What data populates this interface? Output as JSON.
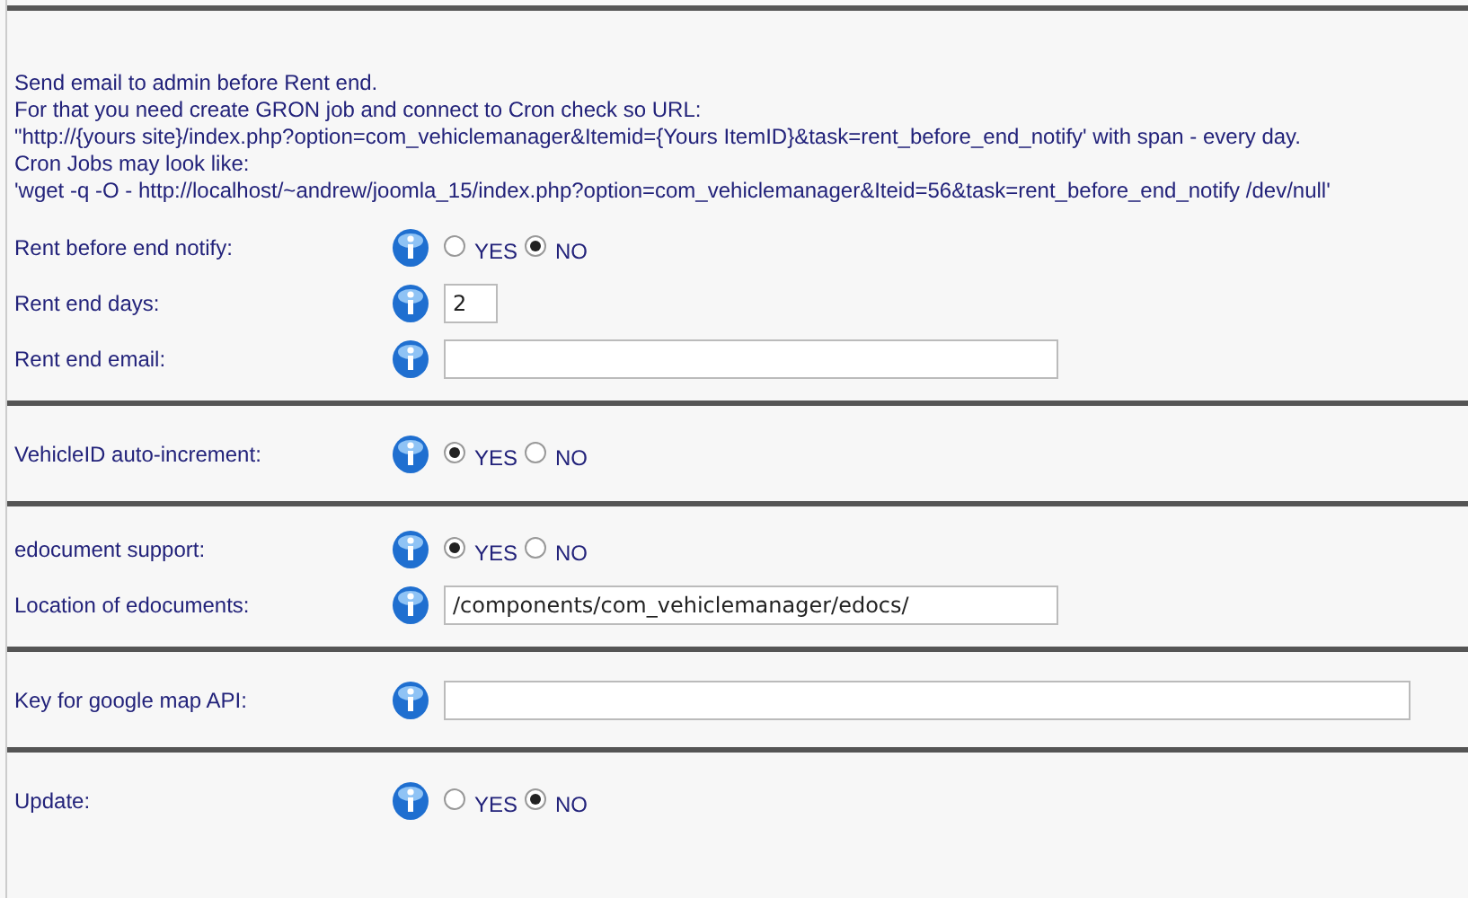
{
  "sections": [
    {
      "intro": [
        "Send email to admin before Rent end.",
        "For that you need create GRON job and connect to Cron check so URL:",
        "\"http://{yours site}/index.php?option=com_vehiclemanager&Itemid={Yours ItemID}&task=rent_before_end_notify' with span - every day.",
        "Cron Jobs may look like:",
        "'wget -q -O - http://localhost/~andrew/joomla_15/index.php?option=com_vehiclemanager&Iteid=56&task=rent_before_end_notify /dev/null'"
      ],
      "rows": [
        {
          "label": "Rent before end notify:",
          "kind": "radio",
          "options": [
            {
              "label": "YES",
              "selected": false
            },
            {
              "label": "NO",
              "selected": true
            }
          ]
        },
        {
          "label": "Rent end days:",
          "kind": "short-text",
          "value": "2"
        },
        {
          "label": "Rent end email:",
          "kind": "text"
        }
      ]
    },
    {
      "rows": [
        {
          "label": "VehicleID auto-increment:",
          "kind": "radio",
          "options": [
            {
              "label": "YES",
              "selected": true
            },
            {
              "label": "NO",
              "selected": false
            }
          ]
        }
      ]
    },
    {
      "rows": [
        {
          "label": "edocument support:",
          "kind": "radio",
          "options": [
            {
              "label": "YES",
              "selected": true
            },
            {
              "label": "NO",
              "selected": false
            }
          ]
        },
        {
          "label": "Location of edocuments:",
          "kind": "text",
          "value": "/components/com_vehiclemanager/edocs/"
        }
      ]
    },
    {
      "rows": [
        {
          "label": "Key for google map API:",
          "kind": "long-text"
        }
      ]
    },
    {
      "rows": [
        {
          "label": "Update:",
          "kind": "radio",
          "options": [
            {
              "label": "YES",
              "selected": false
            },
            {
              "label": "NO",
              "selected": true
            }
          ]
        }
      ]
    }
  ]
}
